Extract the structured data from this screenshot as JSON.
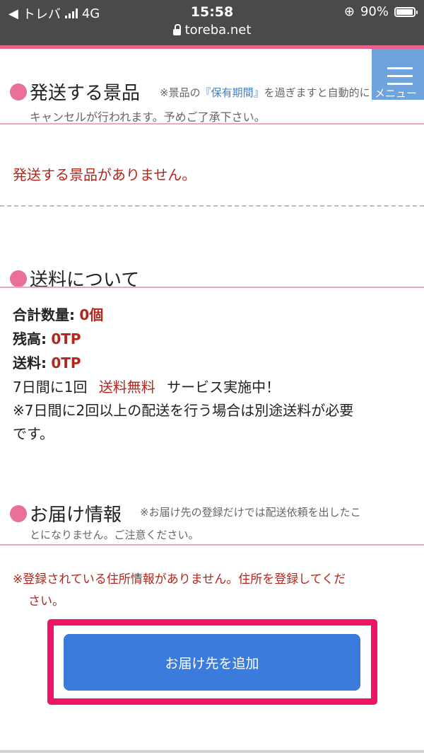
{
  "status_bar": {
    "back_app": "トレバ",
    "network": "4G",
    "time": "15:58",
    "battery": "90%",
    "url": "toreba.net"
  },
  "menu": {
    "label": "メニュー"
  },
  "shipping_items": {
    "title": "発送する景品",
    "note_prefix": "※景品の",
    "note_link": "『保有期間』",
    "note_suffix": "を過ぎますと自動的に",
    "note_line2": "キャンセルが行われます。予めご了承下さい。",
    "empty_message": "発送する景品がありません。"
  },
  "shipping_fee": {
    "title": "送料について",
    "total_qty_label": "合計数量:",
    "total_qty_value": "0個",
    "balance_label": "残高:",
    "balance_value": "0TP",
    "fee_label": "送料:",
    "fee_value": "0TP",
    "promo_prefix": "7日間に1回",
    "promo_highlight": "送料無料",
    "promo_suffix": "サービス実施中！",
    "caution_line1": "※7日間に2回以上の配送を行う場合は別途送料が必要",
    "caution_line2": "です。"
  },
  "delivery_info": {
    "title": "お届け情報",
    "note_line1": "※お届け先の登録だけでは配送依頼を出したこ",
    "note_line2": "とになりません。ご注意ください。",
    "error_line1": "※登録されている住所情報がありません。住所を登録してくだ",
    "error_line2": "さい。",
    "add_button": "お届け先を追加"
  }
}
